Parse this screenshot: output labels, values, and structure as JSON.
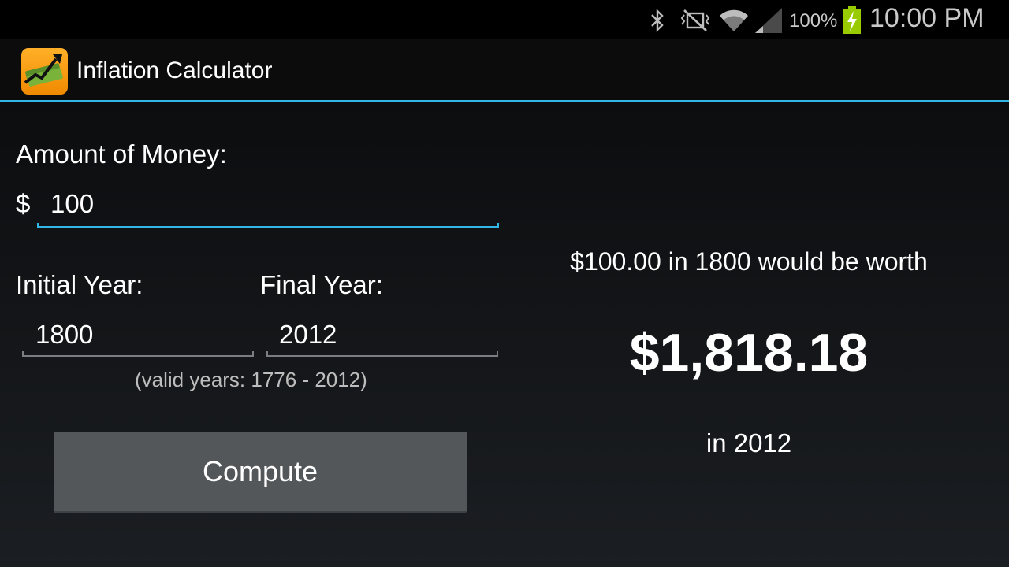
{
  "status_bar": {
    "battery_percent": "100%",
    "time": "10:00 PM",
    "icons": [
      "bluetooth-icon",
      "vibrate-icon",
      "wifi-icon",
      "signal-icon",
      "battery-charging-icon"
    ]
  },
  "app": {
    "title": "Inflation Calculator",
    "icon": "money-chart-icon"
  },
  "form": {
    "amount_label": "Amount of Money:",
    "currency_symbol": "$",
    "amount_value": "100",
    "initial_year_label": "Initial Year:",
    "initial_year_value": "1800",
    "final_year_label": "Final Year:",
    "final_year_value": "2012",
    "valid_years_hint": "(valid years: 1776 - 2012)",
    "compute_label": "Compute"
  },
  "result": {
    "line1": "$100.00 in 1800 would be worth",
    "amount": "$1,818.18",
    "line2": "in 2012"
  },
  "colors": {
    "accent": "#33b5e5",
    "button": "#545759",
    "app_icon": "#f6a01a"
  }
}
